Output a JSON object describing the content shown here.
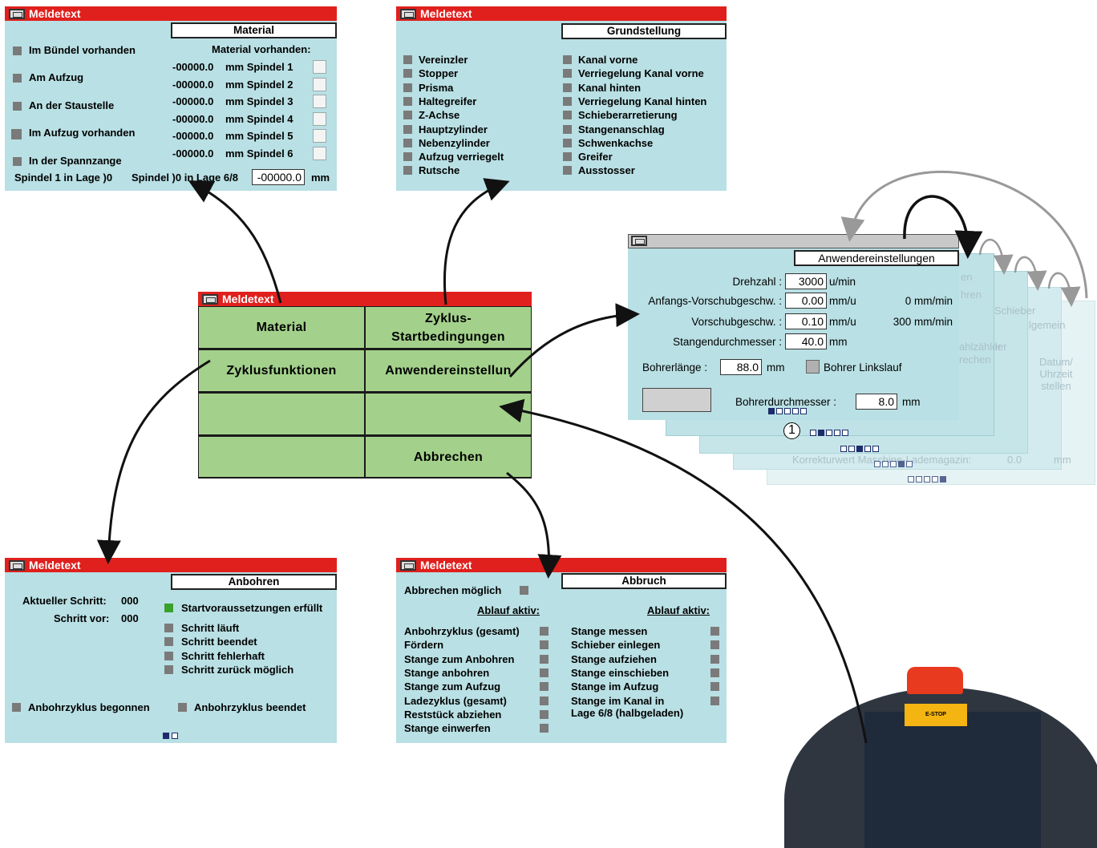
{
  "material_panel": {
    "title": "Meldetext",
    "tab": "Material",
    "left_items": [
      "Im Bündel vorhanden",
      "Am Aufzug",
      "An der Staustelle",
      "Im Aufzug vorhanden",
      "In der Spannzange"
    ],
    "header": "Material vorhanden:",
    "spindles": [
      {
        "value": "-00000.0",
        "label": "mm Spindel 1"
      },
      {
        "value": "-00000.0",
        "label": "mm Spindel 2"
      },
      {
        "value": "-00000.0",
        "label": "mm Spindel 3"
      },
      {
        "value": "-00000.0",
        "label": "mm Spindel 4"
      },
      {
        "value": "-00000.0",
        "label": "mm Spindel 5"
      },
      {
        "value": "-00000.0",
        "label": "mm Spindel 6"
      }
    ],
    "footer_a": "Spindel 1 in Lage )0",
    "footer_b": "Spindel )0  in Lage 6/8",
    "footer_value": "-00000.0",
    "footer_unit": "mm"
  },
  "grund_panel": {
    "title": "Meldetext",
    "tab": "Grundstellung",
    "col1": [
      "Vereinzler",
      "Stopper",
      "Prisma",
      "Haltegreifer",
      "Z-Achse",
      "Hauptzylinder",
      "Nebenzylinder",
      "Aufzug verriegelt",
      "Rutsche"
    ],
    "col2": [
      "Kanal vorne",
      "Verriegelung Kanal vorne",
      "Kanal hinten",
      "Verriegelung Kanal hinten",
      "Schieberarretierung",
      "Stangenanschlag",
      "Schwenkachse",
      "Greifer",
      "Ausstosser"
    ]
  },
  "menu_panel": {
    "title": "Meldetext",
    "buttons": [
      "Material",
      "Zyklus-\nStartbedingungen",
      "Zyklusfunktionen",
      "Anwendereinstellun",
      "",
      "",
      "",
      "Abbrechen"
    ]
  },
  "settings_panel": {
    "tab": "Anwendereinstellungen",
    "rows": [
      {
        "label": "Drehzahl :",
        "value": "3000",
        "unit": "u/min",
        "extra": ""
      },
      {
        "label": "Anfangs-Vorschubgeschw. :",
        "value": "0.00",
        "unit": "mm/u",
        "extra": "0 mm/min"
      },
      {
        "label": "Vorschubgeschw. :",
        "value": "0.10",
        "unit": "mm/u",
        "extra": "300 mm/min"
      },
      {
        "label": "Stangendurchmesser :",
        "value": "40.0",
        "unit": "mm",
        "extra": ""
      }
    ],
    "bohrer_label": "Bohrerlänge :",
    "bohrer_value": "88.0",
    "bohrer_unit": "mm",
    "linkslauf": "Bohrer Linkslauf",
    "durchmesser_label": "Bohrerdurchmesser :",
    "durchmesser_value": "8.0",
    "durchmesser_unit": "mm",
    "marker": "1",
    "behind_fragments": [
      "en",
      "hren",
      "Schieber",
      "lgemein",
      "ahlzähler",
      "rechen",
      "ler",
      "Datum/\nUhrzeit\nstellen",
      "Korrekturwert Maschine-Lademagazin:",
      "0.0",
      "mm"
    ]
  },
  "anbohren_panel": {
    "title": "Meldetext",
    "tab": "Anbohren",
    "step_label": "Aktueller Schritt:",
    "step_value": "000",
    "prev_label": "Schritt vor:",
    "prev_value": "000",
    "status": [
      "Startvoraussetzungen erfüllt",
      "Schritt läuft",
      "Schritt beendet",
      "Schritt fehlerhaft",
      "Schritt zurück möglich"
    ],
    "bottom": [
      "Anbohrzyklus begonnen",
      "Anbohrzyklus beendet"
    ]
  },
  "abbruch_panel": {
    "title": "Meldetext",
    "tab": "Abbruch",
    "possible": "Abbrechen möglich",
    "ablauf": "Ablauf aktiv:",
    "col1": [
      "Anbohrzyklus (gesamt)",
      "Fördern",
      "Stange zum Anbohren",
      "Stange anbohren",
      "Stange zum Aufzug",
      "Ladezyklus (gesamt)",
      "Reststück abziehen",
      "Stange einwerfen"
    ],
    "col2": [
      "Stange messen",
      "Schieber einlegen",
      "Stange aufziehen",
      "Stange einschieben",
      "Stange im Aufzug",
      "Stange im Kanal in\nLage 6/8 (halbgeladen)"
    ]
  },
  "device": {
    "estop_label": "E-STOP"
  },
  "colors": {
    "panel": "#b9e0e4",
    "title": "#e0201d",
    "button": "#a3d18b",
    "indicator": "#7a7a7a",
    "ok": "#3aa02c"
  }
}
